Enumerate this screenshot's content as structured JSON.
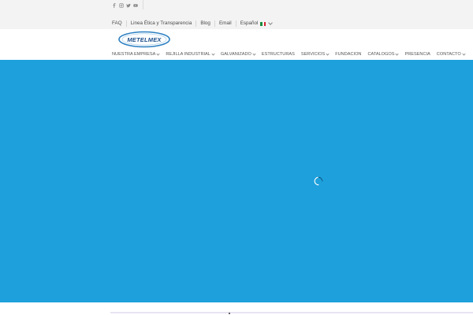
{
  "social": {
    "icons": [
      "facebook-icon",
      "instagram-icon",
      "twitter-icon",
      "youtube-icon"
    ]
  },
  "toplinks": {
    "faq": "FAQ",
    "etica": "Linea Ética y Transparencia",
    "blog": "Blog",
    "email": "Email",
    "language": "Español"
  },
  "logo": {
    "text": "METELMEX"
  },
  "nav": {
    "items": [
      {
        "label": "NUESTRA EMPRESA",
        "dropdown": true
      },
      {
        "label": "REJILLA INDUSTRIAL",
        "dropdown": true
      },
      {
        "label": "GALVANIZADO",
        "dropdown": true
      },
      {
        "label": "ESTRUCTURAS",
        "dropdown": false
      },
      {
        "label": "SERVICIOS",
        "dropdown": true
      },
      {
        "label": "FUNDACION",
        "dropdown": false
      },
      {
        "label": "CATALOGOS",
        "dropdown": true
      },
      {
        "label": "PRESENCIA",
        "dropdown": false
      },
      {
        "label": "CONTACTO",
        "dropdown": true
      }
    ]
  },
  "colors": {
    "hero": "#1ea0dc",
    "topbar": "#f3f3f3",
    "logo_ring": "#2c7fc1",
    "logo_text": "#1d4f8c"
  }
}
